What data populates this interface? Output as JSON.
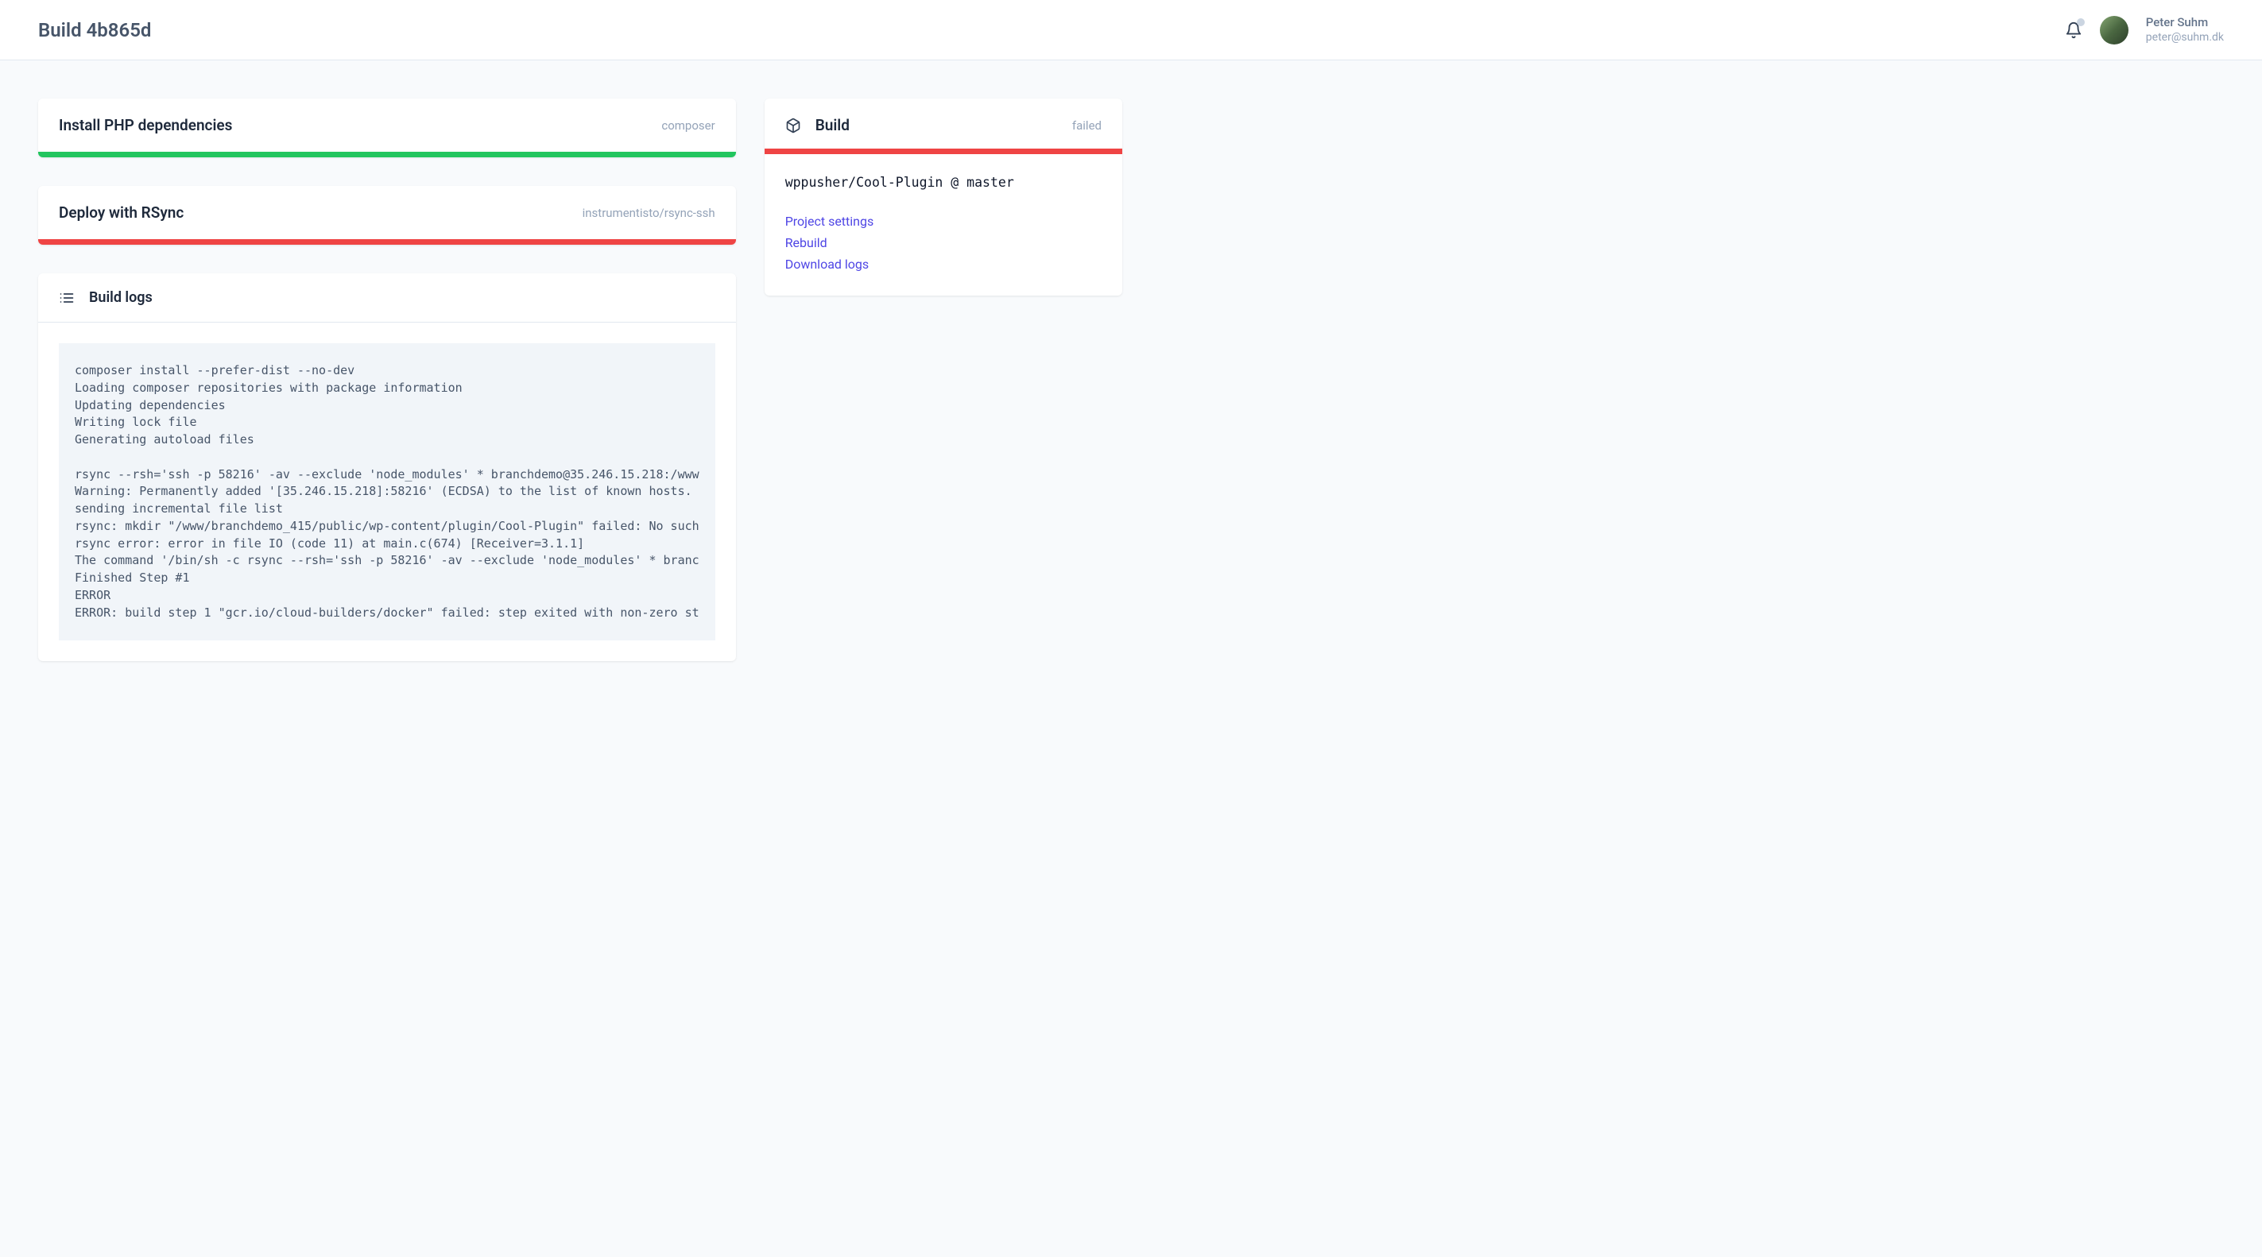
{
  "header": {
    "title": "Build 4b865d",
    "user_name": "Peter Suhm",
    "user_email": "peter@suhm.dk"
  },
  "steps": [
    {
      "title": "Install PHP dependencies",
      "meta": "composer",
      "status": "success"
    },
    {
      "title": "Deploy with RSync",
      "meta": "instrumentisto/rsync-ssh",
      "status": "failed"
    }
  ],
  "logs": {
    "title": "Build logs",
    "content": "composer install --prefer-dist --no-dev\nLoading composer repositories with package information\nUpdating dependencies\nWriting lock file\nGenerating autoload files\n\nrsync --rsh='ssh -p 58216' -av --exclude 'node_modules' * branchdemo@35.246.15.218:/www\nWarning: Permanently added '[35.246.15.218]:58216' (ECDSA) to the list of known hosts.\nsending incremental file list\nrsync: mkdir \"/www/branchdemo_415/public/wp-content/plugin/Cool-Plugin\" failed: No such\nrsync error: error in file IO (code 11) at main.c(674) [Receiver=3.1.1]\nThe command '/bin/sh -c rsync --rsh='ssh -p 58216' -av --exclude 'node_modules' * branc\nFinished Step #1\nERROR\nERROR: build step 1 \"gcr.io/cloud-builders/docker\" failed: step exited with non-zero st"
  },
  "sidebar": {
    "title": "Build",
    "status": "failed",
    "repo": "wppusher/Cool-Plugin @ master",
    "links": {
      "settings": "Project settings",
      "rebuild": "Rebuild",
      "download_logs": "Download logs"
    }
  }
}
